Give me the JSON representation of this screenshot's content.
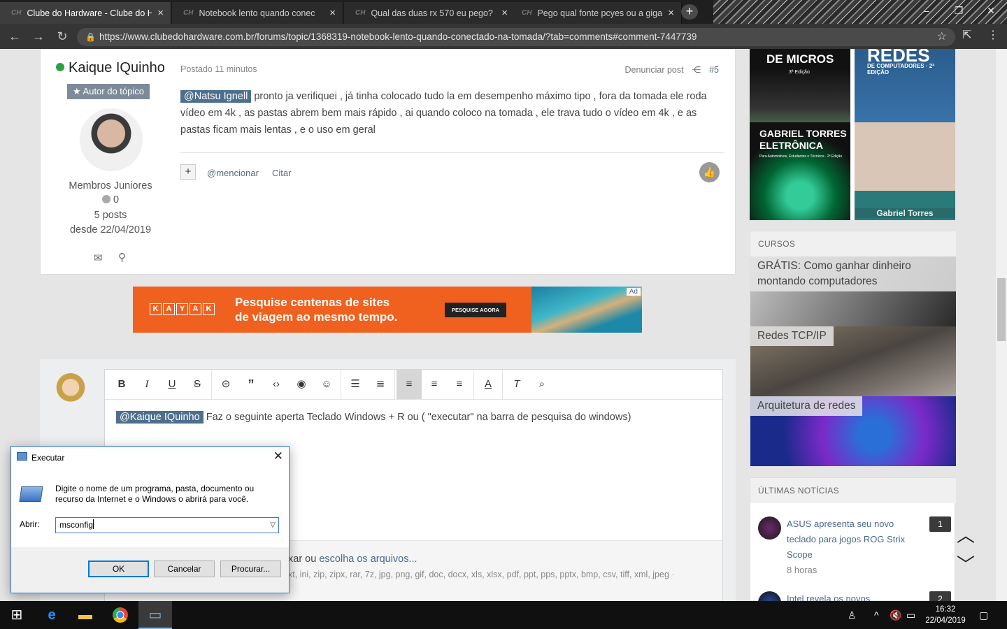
{
  "browser": {
    "tabs": [
      {
        "label": "Clube do Hardware - Clube do H",
        "active": true
      },
      {
        "label": "Notebook lento quando conec",
        "active": false
      },
      {
        "label": "Qual das duas rx 570 eu pego? -",
        "active": false
      },
      {
        "label": "Pego qual fonte pcyes ou a gigat",
        "active": false
      }
    ],
    "favicon": "CH",
    "close": "×",
    "newtab": "+",
    "url": "https://www.clubedohardware.com.br/forums/topic/1368319-notebook-lento-quando-conectado-na-tomada/?tab=comments#comment-7447739"
  },
  "post": {
    "author": "Kaique IQuinho",
    "badge": "★ Autor do tópico",
    "group": "Membros Juniores",
    "reputation": "0",
    "posts": "5 posts",
    "since": "desde 22/04/2019",
    "posted": "Postado 11 minutos",
    "report": "Denunciar post",
    "number": "#5",
    "mention": "@Natsu Ignell",
    "text": " pronto ja verifiquei , já tinha colocado tudo la em desempenho máximo tipo , fora da tomada ele roda vídeo em 4k , as pastas abrem bem mais rápido , ai quando coloco na tomada , ele trava tudo o vídeo em 4k , e as pastas ficam mais lentas , e o uso em geral",
    "mention_action": "@mencionar",
    "quote_action": "Citar"
  },
  "ad": {
    "brand": [
      "K",
      "A",
      "Y",
      "A",
      "K"
    ],
    "line1": "Pesquise centenas de sites",
    "line2": "de viagem ao mesmo tempo.",
    "cta": "PESQUISE AGORA",
    "tag": "Ad"
  },
  "editor": {
    "mention": "@Kaique IQuinho",
    "text": " Faz o seguinte aperta Teclado Windows + R ou ( \"executar\" na barra de pesquisa do windows)",
    "attach_prefix": "xar ou ",
    "attach_link": "escolha os arquivos...",
    "extensions": "xt, ini, zip, zipx, rar, 7z, jpg, png, gif, doc, docx, xls, xlsx, pdf, ppt, pps, pptx, bmp, csv, tiff, xml, jpeg ·"
  },
  "sidebar": {
    "books": [
      {
        "title": "DE MICROS",
        "subtitle": "3ª Edição"
      },
      {
        "title": "REDES",
        "subtitle": "DE COMPUTADORES · 2ª EDIÇÃO"
      },
      {
        "title": "GABRIEL TORRES ELETRÔNICA",
        "subtitle": "Para Automotivos, Estudantes e Técnicos · 2ª Edição"
      },
      {
        "title": "Gabriel Torres",
        "subtitle": ""
      }
    ],
    "courses_header": "CURSOS",
    "courses": [
      "GRÁTIS: Como ganhar dinheiro montando computadores",
      "Redes TCP/IP",
      "Arquitetura de redes"
    ],
    "news_header": "ÚLTIMAS NOTÍCIAS",
    "news": [
      {
        "title": "ASUS apresenta seu novo teclado para jogos ROG Strix Scope",
        "time": "8 horas",
        "count": "1"
      },
      {
        "title": "Intel revela os novos",
        "time": "",
        "count": "2"
      }
    ]
  },
  "run_dialog": {
    "title": "Executar",
    "description": "Digite o nome de um programa, pasta, documento ou recurso da Internet e o Windows o abrirá para você.",
    "label": "Abrir:",
    "value": "msconfig",
    "ok": "OK",
    "cancel": "Cancelar",
    "browse": "Procurar..."
  },
  "taskbar": {
    "time": "16:32",
    "date": "22/04/2019"
  }
}
